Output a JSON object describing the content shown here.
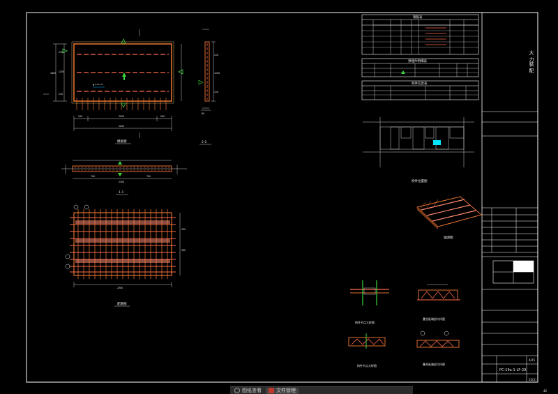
{
  "colors": {
    "background": "#000000",
    "frame": "#ffffff",
    "beam": "#e07030",
    "grid": "#ff6b4a",
    "accent_green": "#3cd43c",
    "accent_cyan": "#00e5ff",
    "text": "#e8e8e8"
  },
  "title_block": {
    "company": "大 力装 配",
    "field1": "PC-19a-1-LF-29",
    "field2": "4/25",
    "field3": "25(2)"
  },
  "tables": {
    "table1_title": "钢筋表",
    "table2_title": "预埋件明细表",
    "table3_title": "构件信息表"
  },
  "views": {
    "view1_caption": "模板图",
    "view2_caption": "1-1",
    "view3_caption": "2-2",
    "view4_caption": "配筋图",
    "view5_caption": "构件位置图",
    "view6_caption": "轴测图",
    "view7_caption": "构件节点大样图",
    "view8_caption": "叠合板端部大样图"
  },
  "taskbar": {
    "item1": "图纸查看",
    "item2": "文件管理"
  },
  "page_corner": "42"
}
